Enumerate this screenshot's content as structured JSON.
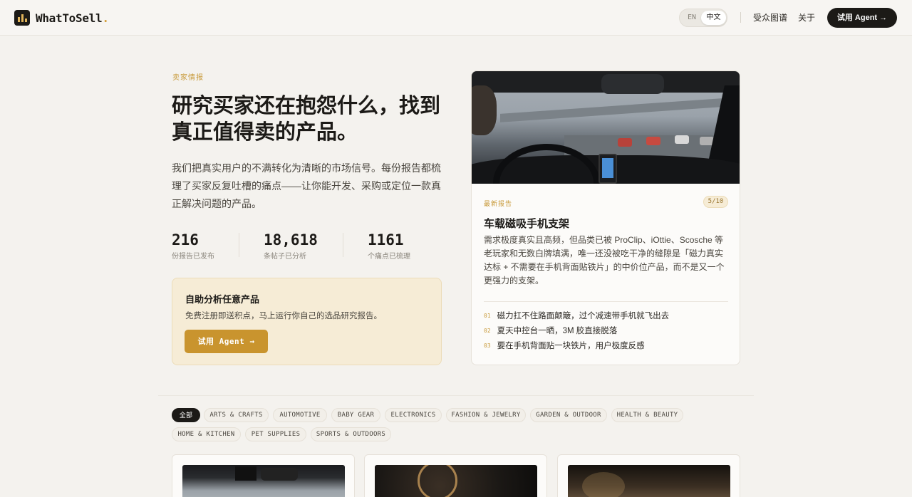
{
  "header": {
    "logo_text": "WhatToSell",
    "logo_dot": ".",
    "lang_en": "EN",
    "lang_zh": "中文",
    "nav": [
      "受众图谱",
      "关于"
    ],
    "cta": "试用 Agent →"
  },
  "hero": {
    "eyebrow": "卖家情报",
    "title": "研究买家还在抱怨什么，找到真正值得卖的产品。",
    "description": "我们把真实用户的不满转化为清晰的市场信号。每份报告都梳理了买家反复吐槽的痛点——让你能开发、采购或定位一款真正解决问题的产品。",
    "stats": [
      {
        "value": "216",
        "label": "份报告已发布"
      },
      {
        "value": "18,618",
        "label": "条帖子已分析"
      },
      {
        "value": "1161",
        "label": "个痛点已梳理"
      }
    ]
  },
  "self_serve": {
    "title": "自助分析任意产品",
    "description": "免费注册即送积点，马上运行你自己的选品研究报告。",
    "button": "试用 Agent →"
  },
  "featured": {
    "tag": "最新报告",
    "badge": "5/10",
    "title": "车载磁吸手机支架",
    "description": "需求极度真实且高频，但品类已被 ProClip、iOttie、Scosche 等老玩家和无数白牌填满，唯一还没被吃干净的缝隙是「磁力真实达标 + 不需要在手机背面贴铁片」的中价位产品，而不是又一个更强力的支架。",
    "points": [
      {
        "num": "01",
        "text": "磁力扛不住路面颠簸，过个减速带手机就飞出去"
      },
      {
        "num": "02",
        "text": "夏天中控台一晒，3M 胶直接脱落"
      },
      {
        "num": "03",
        "text": "要在手机背面贴一块铁片，用户极度反感"
      }
    ]
  },
  "filters": {
    "row1": [
      "全部",
      "ARTS & CRAFTS",
      "AUTOMOTIVE",
      "BABY GEAR",
      "ELECTRONICS",
      "FASHION & JEWELRY",
      "GARDEN & OUTDOOR",
      "HEALTH & BEAUTY"
    ],
    "row2": [
      "HOME & KITCHEN",
      "PET SUPPLIES",
      "SPORTS & OUTDOORS"
    ]
  }
}
